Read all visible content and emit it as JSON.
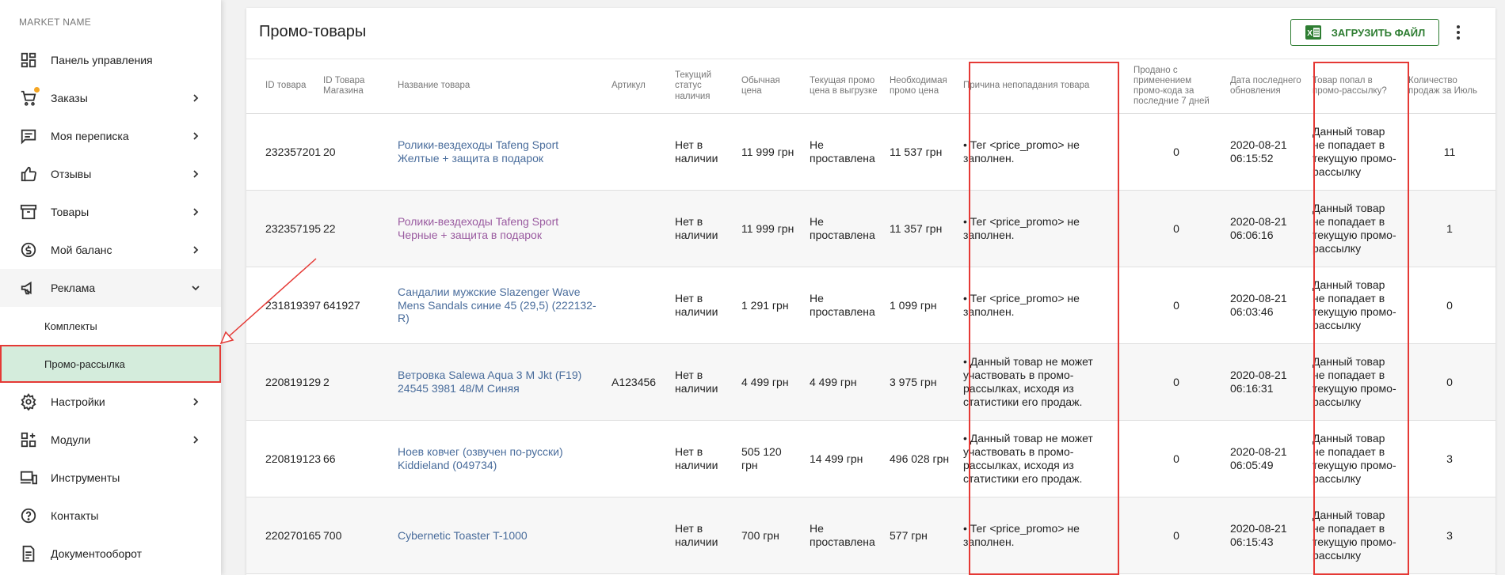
{
  "sidebar": {
    "market_name": "MARKET NAME",
    "items": [
      {
        "label": "Панель управления",
        "icon": "dashboard-icon"
      },
      {
        "label": "Заказы",
        "icon": "cart-icon"
      },
      {
        "label": "Моя переписка",
        "icon": "chat-icon"
      },
      {
        "label": "Отзывы",
        "icon": "thumbs-up-icon"
      },
      {
        "label": "Товары",
        "icon": "box-icon"
      },
      {
        "label": "Мой баланс",
        "icon": "balance-icon"
      },
      {
        "label": "Реклама",
        "icon": "megaphone-icon"
      }
    ],
    "sub_items": [
      {
        "label": "Комплекты"
      },
      {
        "label": "Промо-рассылка"
      }
    ],
    "items_after": [
      {
        "label": "Настройки",
        "icon": "gear-icon"
      },
      {
        "label": "Модули",
        "icon": "modules-icon"
      },
      {
        "label": "Инструменты",
        "icon": "devices-icon"
      },
      {
        "label": "Контакты",
        "icon": "help-icon"
      },
      {
        "label": "Документооборот",
        "icon": "document-icon"
      }
    ]
  },
  "page": {
    "title": "Промо-товары",
    "upload_label": "ЗАГРУЗИТЬ ФАЙЛ"
  },
  "table": {
    "headers": {
      "id": "ID товара",
      "store_id": "ID Товара Магазина",
      "name": "Название товара",
      "article": "Артикул",
      "status": "Текущий статус наличия",
      "price": "Обычная цена",
      "promo_price": "Текущая промо цена в выгрузке",
      "need_price": "Необходимая промо цена",
      "reason": "Причина непопадания товара",
      "sold": "Продано с применением промо-кода за последние 7 дней",
      "updated": "Дата последнего обновления",
      "in_promo": "Товар попал в промо-рассылку?",
      "sales_july": "Количество продаж за Июль"
    },
    "rows": [
      {
        "id": "232357201",
        "store_id": "20",
        "name": "Ролики-вездеходы Tafeng Sport Желтые + защита в подарок",
        "article": "",
        "status": "Нет в наличии",
        "price": "11 999 грн",
        "promo_price": "Не проставлена",
        "need_price": "11 537 грн",
        "reason": "• Тег <price_promo> не заполнен.",
        "sold": "0",
        "updated": "2020-08-21 06:15:52",
        "in_promo": "Данный товар не попадает в текущую промо-рассылку",
        "sales_july": "11"
      },
      {
        "id": "232357195",
        "store_id": "22",
        "name": "Ролики-вездеходы Tafeng Sport Черные + защита в подарок",
        "article": "",
        "status": "Нет в наличии",
        "price": "11 999 грн",
        "promo_price": "Не проставлена",
        "need_price": "11 357 грн",
        "reason": "• Тег <price_promo> не заполнен.",
        "sold": "0",
        "updated": "2020-08-21 06:06:16",
        "in_promo": "Данный товар не попадает в текущую промо-рассылку",
        "sales_july": "1"
      },
      {
        "id": "231819397",
        "store_id": "641927",
        "name": "Сандалии мужские Slazenger Wave Mens Sandals синие 45 (29,5) (222132-R)",
        "article": "",
        "status": "Нет в наличии",
        "price": "1 291 грн",
        "promo_price": "Не проставлена",
        "need_price": "1 099 грн",
        "reason": "• Тег <price_promo> не заполнен.",
        "sold": "0",
        "updated": "2020-08-21 06:03:46",
        "in_promo": "Данный товар не попадает в текущую промо-рассылку",
        "sales_july": "0"
      },
      {
        "id": "220819129",
        "store_id": "2",
        "name": "Ветровка Salewa Aqua 3 M Jkt (F19) 24545 3981 48/M Синяя",
        "article": "A123456",
        "status": "Нет в наличии",
        "price": "4 499 грн",
        "promo_price": "4 499 грн",
        "need_price": "3 975 грн",
        "reason": "• Данный товар не может участвовать в промо-рассылках, исходя из статистики его продаж.",
        "sold": "0",
        "updated": "2020-08-21 06:16:31",
        "in_promo": "Данный товар не попадает в текущую промо-рассылку",
        "sales_july": "0"
      },
      {
        "id": "220819123",
        "store_id": "66",
        "name": "Ноев ковчег (озвучен по-русски) Kiddieland (049734)",
        "article": "",
        "status": "Нет в наличии",
        "price": "505 120 грн",
        "promo_price": "14 499 грн",
        "need_price": "496 028 грн",
        "reason": "• Данный товар не может участвовать в промо-рассылках, исходя из статистики его продаж.",
        "sold": "0",
        "updated": "2020-08-21 06:05:49",
        "in_promo": "Данный товар не попадает в текущую промо-рассылку",
        "sales_july": "3"
      },
      {
        "id": "220270165",
        "store_id": "700",
        "name": "Cybernetic Toaster T-1000",
        "article": "",
        "status": "Нет в наличии",
        "price": "700 грн",
        "promo_price": "Не проставлена",
        "need_price": "577 грн",
        "reason": "• Тег <price_promo> не заполнен.",
        "sold": "0",
        "updated": "2020-08-21 06:15:43",
        "in_promo": "Данный товар не попадает в текущую промо-рассылку",
        "sales_july": "3"
      }
    ]
  },
  "colors": {
    "accent_green": "#2e7d32",
    "active_bg": "#d4ecdc",
    "highlight_red": "#e53935",
    "link_blue": "#4a6d9c",
    "link_visited": "#9a5ba0"
  }
}
